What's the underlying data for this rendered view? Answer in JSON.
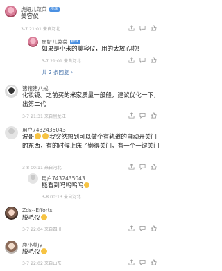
{
  "comments": [
    {
      "username": "虎妞儿菜菜",
      "text": "美容仪",
      "meta": "3-7 21:01 来自河北",
      "replies": [
        {
          "username": "虎妞儿菜菜",
          "text": "如果是小米的美容仪，用的太放心啦!",
          "meta": "3-7 21:01 来自河北"
        }
      ],
      "more_replies": "共 2 条回复"
    },
    {
      "username": "猪猪猪八戒_",
      "text": "化妆镜。之前买的米家质量一般般，建议优化一下，出第二代",
      "meta": "3-7 21:31 来自黑龙江"
    },
    {
      "username": "用户7432435043",
      "text_lead": "波哥",
      "text": "我突然想到可以做个有轨道的自动开关门的东西，有的时候上床了懒得关门，有一个一键关门",
      "meta": "3-8 00:11 来自河北",
      "replies": [
        {
          "username": "用户7432435043",
          "text": "能看到吗呜呜呜",
          "meta": "3-8 00:13 来自河北"
        }
      ]
    },
    {
      "username": "Zds--Efforts",
      "text": "脱毛仪",
      "meta": "3-7 22:04 来自四川"
    },
    {
      "username": "鹿小葵jy",
      "text": "脱毛仪",
      "meta": "3-7 22:02 来自山东"
    }
  ],
  "badge_label": "粉丝",
  "icons": [
    "share-icon",
    "comment-icon",
    "like-icon"
  ],
  "colors": {
    "link": "#3f6ea8",
    "badge": "#4a90e2",
    "meta": "#aaaaaa"
  }
}
